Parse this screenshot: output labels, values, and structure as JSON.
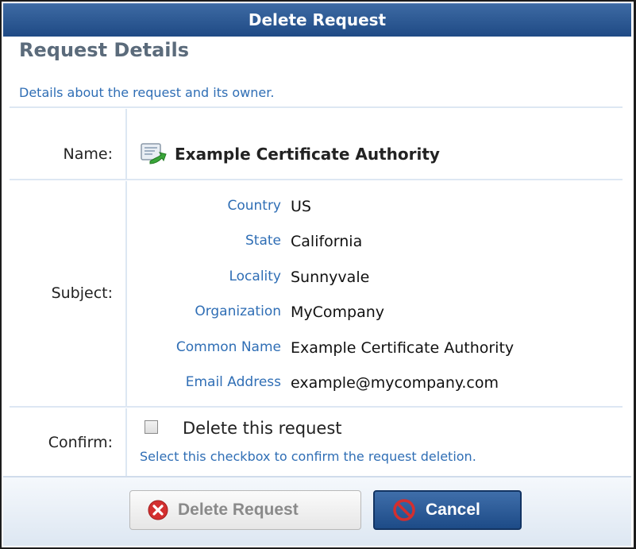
{
  "dialog": {
    "title": "Delete Request"
  },
  "section": {
    "title": "Request Details",
    "description": "Details about the request and its owner."
  },
  "fields": {
    "name_label": "Name:",
    "name_value": "Example Certificate Authority",
    "subject_label": "Subject:",
    "confirm_label": "Confirm:"
  },
  "subject": [
    {
      "key": "Country",
      "value": "US"
    },
    {
      "key": "State",
      "value": "California"
    },
    {
      "key": "Locality",
      "value": "Sunnyvale"
    },
    {
      "key": "Organization",
      "value": "MyCompany"
    },
    {
      "key": "Common Name",
      "value": "Example Certificate Authority"
    },
    {
      "key": "Email Address",
      "value": "example@mycompany.com"
    }
  ],
  "confirm": {
    "checkbox_label": "Delete this request",
    "checked": false,
    "help": "Select this checkbox to confirm the request deletion."
  },
  "buttons": {
    "delete_label": "Delete Request",
    "cancel_label": "Cancel"
  },
  "icons": {
    "name": "certificate-request-icon",
    "delete": "red-x-icon",
    "cancel": "no-symbol-icon"
  },
  "colors": {
    "title_bar": "#2a568f",
    "accent_text": "#2f6eb5",
    "delete_icon": "#d32f2f",
    "cancel_icon": "#d32f2f"
  }
}
